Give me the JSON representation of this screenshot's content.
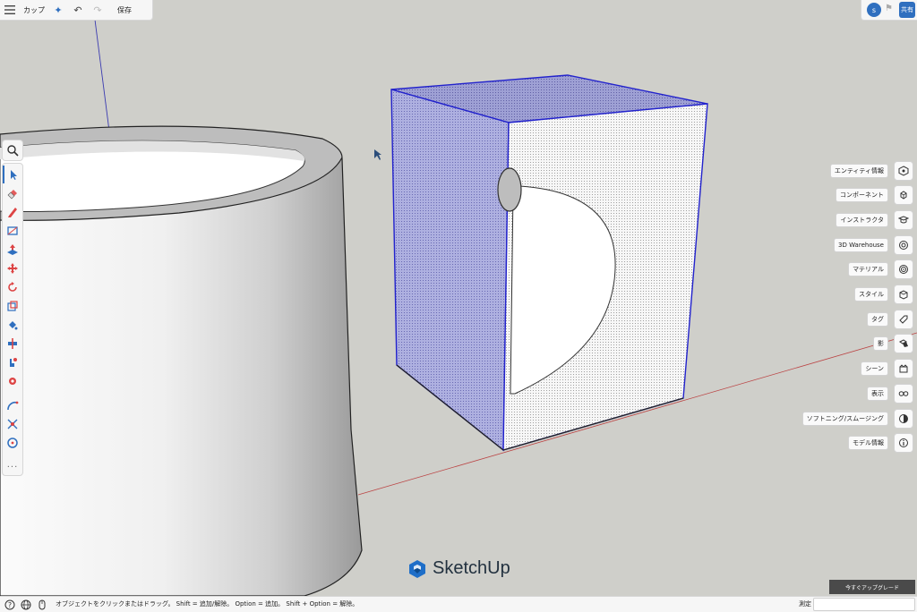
{
  "topbar": {
    "menu_icon": "hamburger-menu-icon",
    "file_name": "カップ",
    "ai_icon": "sparkle-icon",
    "undo_icon": "undo-icon",
    "redo_icon": "redo-icon",
    "save_label": "保存"
  },
  "topright": {
    "account_initial": "s",
    "share_label": "共有"
  },
  "left_tools": [
    {
      "name": "select-tool",
      "icon": "arrow-icon",
      "active": true
    },
    {
      "name": "eraser-tool",
      "icon": "eraser-icon"
    },
    {
      "name": "pencil-tool",
      "icon": "pencil-icon"
    },
    {
      "name": "rectangle-tool",
      "icon": "rectangle-icon"
    },
    {
      "name": "push-pull-tool",
      "icon": "push-pull-icon"
    },
    {
      "name": "move-tool",
      "icon": "move-icon"
    },
    {
      "name": "rotate-tool",
      "icon": "rotate-icon"
    },
    {
      "name": "scale-tool",
      "icon": "scale-icon"
    },
    {
      "name": "paint-bucket-tool",
      "icon": "paint-bucket-icon"
    },
    {
      "name": "section-plane-tool",
      "icon": "section-plane-icon"
    },
    {
      "name": "orbit-tool",
      "icon": "orbit-icon"
    },
    {
      "name": "position-camera-tool",
      "icon": "camera-icon"
    },
    {
      "name": "arc-tool",
      "icon": "arc-icon"
    },
    {
      "name": "zoom-extents-tool",
      "icon": "zoom-extents-icon"
    },
    {
      "name": "circle-tool",
      "icon": "circle-icon"
    }
  ],
  "left_more_label": "...",
  "right_panel": [
    {
      "label": "エンティティ情報",
      "icon": "entity-info-icon"
    },
    {
      "label": "コンポーネント",
      "icon": "components-icon"
    },
    {
      "label": "インストラクタ",
      "icon": "instructor-icon"
    },
    {
      "label": "3D Warehouse",
      "icon": "warehouse-icon"
    },
    {
      "label": "マテリアル",
      "icon": "materials-icon"
    },
    {
      "label": "スタイル",
      "icon": "styles-icon"
    },
    {
      "label": "タグ",
      "icon": "tag-icon"
    },
    {
      "label": "影",
      "icon": "shadow-icon"
    },
    {
      "label": "シーン",
      "icon": "scenes-icon"
    },
    {
      "label": "表示",
      "icon": "display-icon"
    },
    {
      "label": "ソフトニング/スムージング",
      "icon": "soften-icon"
    },
    {
      "label": "モデル情報",
      "icon": "info-icon"
    }
  ],
  "logo_text": "SketchUp",
  "upgrade_label": "今すぐアップグレード",
  "status": {
    "help_icon": "help-icon",
    "globe_icon": "globe-icon",
    "mouse_icon": "mouse-icon",
    "message": "オブジェクトをクリックまたはドラッグ。 Shift = 追加/解除。 Option = 追加。 Shift + Option = 解除。",
    "measure_label": "測定"
  },
  "colors": {
    "accent": "#2f6fbf",
    "selection_edge": "#2222cc",
    "background": "#cfcfca"
  }
}
